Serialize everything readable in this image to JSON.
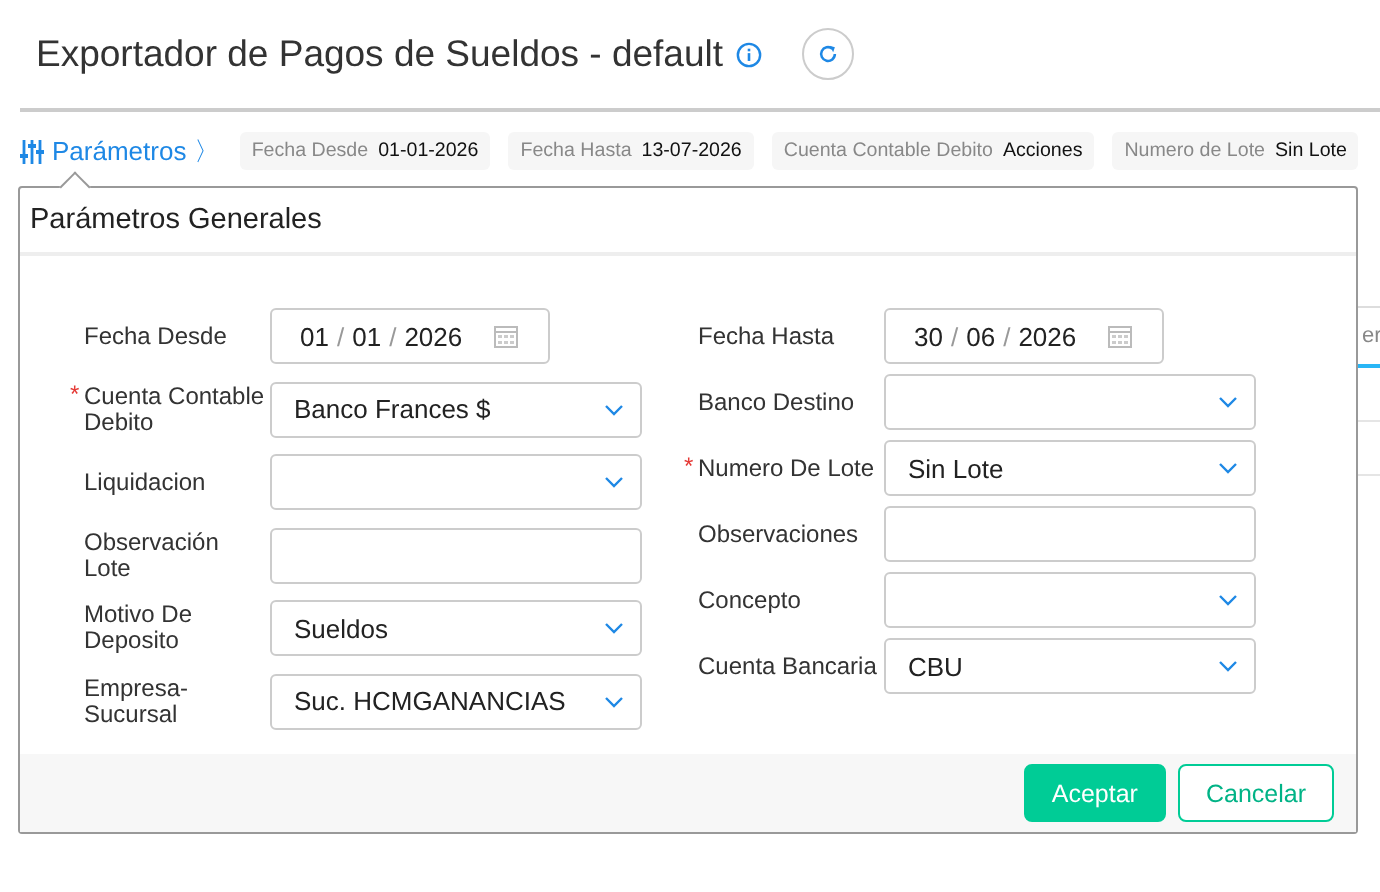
{
  "page": {
    "title": "Exportador de Pagos de Sueldos - default"
  },
  "filter_bar": {
    "toggle": {
      "label": "Parámetros",
      "chevron": "〉"
    },
    "chips": [
      {
        "label": "Fecha Desde",
        "value": "01-01-2026"
      },
      {
        "label": "Fecha Hasta",
        "value": "13-07-2026"
      },
      {
        "label": "Cuenta Contable Debito",
        "value": "Acciones"
      },
      {
        "label": "Numero de Lote",
        "value": "Sin Lote"
      }
    ]
  },
  "background": {
    "field_fragment": "er"
  },
  "dialog": {
    "title": "Parámetros Generales",
    "required_mark": "*",
    "date_separator": "/",
    "columns": [
      [
        {
          "kind": "date",
          "label": "Fecha Desde",
          "required": false,
          "day": "01",
          "month": "01",
          "year": "2026"
        },
        {
          "kind": "select",
          "label": "Cuenta Contable Debito",
          "required": true,
          "value": "Banco Frances $"
        },
        {
          "kind": "select",
          "label": "Liquidacion",
          "required": false
        },
        {
          "kind": "text",
          "label": "Observación Lote",
          "required": false
        },
        {
          "kind": "select",
          "label": "Motivo De Deposito",
          "required": false,
          "value": "Sueldos"
        },
        {
          "kind": "select",
          "label": "Empresa-Sucursal",
          "required": false,
          "value": "Suc. HCMGANANCIAS"
        }
      ],
      [
        {
          "kind": "date",
          "label": "Fecha Hasta",
          "required": false,
          "day": "30",
          "month": "06",
          "year": "2026"
        },
        {
          "kind": "select",
          "label": "Banco Destino",
          "required": false
        },
        {
          "kind": "select",
          "label": "Numero De Lote",
          "required": true,
          "value": "Sin Lote"
        },
        {
          "kind": "text",
          "label": "Observaciones",
          "required": false
        },
        {
          "kind": "select",
          "label": "Concepto",
          "required": false
        },
        {
          "kind": "select",
          "label": "Cuenta Bancaria",
          "required": false,
          "value": "CBU"
        }
      ]
    ],
    "buttons": [
      {
        "kind": "primary",
        "label": "Aceptar"
      },
      {
        "kind": "secondary",
        "label": "Cancelar"
      }
    ]
  }
}
